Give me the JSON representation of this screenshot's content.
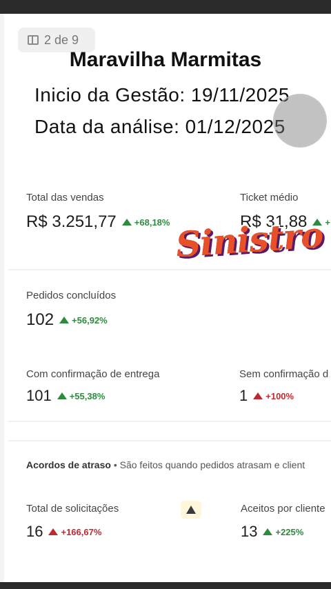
{
  "pager": {
    "label": "2 de 9"
  },
  "header": {
    "title": "Maravilha Marmitas",
    "start_line": "Inicio da Gestão:  19/11/2025",
    "analysis_line": "Data da análise: 01/12/2025"
  },
  "watermark": {
    "text": "Sinistro"
  },
  "metrics": {
    "total_vendas": {
      "label": "Total das vendas",
      "value": "R$ 3.251,77",
      "delta": "+68,18%",
      "direction": "up"
    },
    "ticket_medio": {
      "label": "Ticket médio",
      "value": "R$ 31,88",
      "delta": "+",
      "direction": "up"
    },
    "pedidos_concluidos": {
      "label": "Pedidos concluídos",
      "value": "102",
      "delta": "+56,92%",
      "direction": "up"
    },
    "com_confirmacao": {
      "label": "Com confirmação de entrega",
      "value": "101",
      "delta": "+55,38%",
      "direction": "up"
    },
    "sem_confirmacao": {
      "label": "Sem confirmação d",
      "value": "1",
      "delta": "+100%",
      "direction": "up-negative"
    }
  },
  "acordos": {
    "title": "Acordos de atraso",
    "separator": "•",
    "description": "São feitos quando pedidos atrasam e client",
    "total_solicitacoes": {
      "label": "Total de solicitações",
      "value": "16",
      "delta": "+166,67%",
      "direction": "up-negative"
    },
    "aceitos": {
      "label": "Aceitos por cliente",
      "value": "13",
      "delta": "+225%",
      "direction": "up"
    }
  },
  "colors": {
    "positive": "#2e8b3d",
    "negative": "#c0292f",
    "warning_bg": "#fff6dc"
  },
  "icons": {
    "pager": "panel-icon",
    "warning": "warning-icon"
  }
}
